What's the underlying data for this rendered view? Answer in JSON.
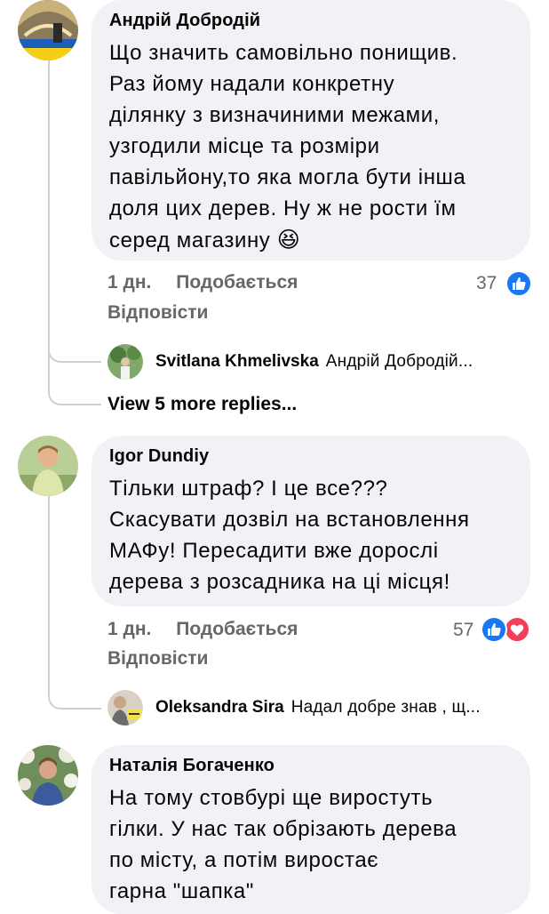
{
  "comments": [
    {
      "author": "Андрій Добродій",
      "text": "Що значить самовільно понищив.\nРаз йому надали конкретну\nділянку з визначиними межами,\nузгодили місце та розміри\nпавільйону,то яка могла бути інша\nдоля цих дерев. Ну ж не рости їм\nсеред магазину",
      "emoji": "😆",
      "time": "1 дн.",
      "like_label": "Подобається",
      "reply_label": "Відповісти",
      "reaction_count": "37",
      "reactions": [
        "like-icon"
      ],
      "reply_preview": {
        "author": "Svitlana Khmelivska",
        "snippet": "Андрій Добродій..."
      },
      "more_replies": "View 5 more replies..."
    },
    {
      "author": "Igor Dundiy",
      "text": "Тільки штраф? І це все???\nСкасувати дозвіл на встановлення\nМАФу! Пересадити вже дорослі\nдерева з    розсадника на ці місця!",
      "time": "1 дн.",
      "like_label": "Подобається",
      "reply_label": "Відповісти",
      "reaction_count": "57",
      "reactions": [
        "like-icon",
        "love-icon"
      ],
      "reply_preview": {
        "author": "Oleksandra Sira",
        "snippet": "Надал добре знав , щ..."
      }
    },
    {
      "author": "Наталія Богаченко",
      "text": "На тому стовбурі ще виростуть\nгілки. У нас так обрізають дерева\nпо місту, а потім виростає\nгарна \"шапка\""
    }
  ],
  "colors": {
    "like": "#1877f2",
    "love": "#f33e58",
    "meta": "#65676b",
    "bubble": "#f0f2f5"
  }
}
